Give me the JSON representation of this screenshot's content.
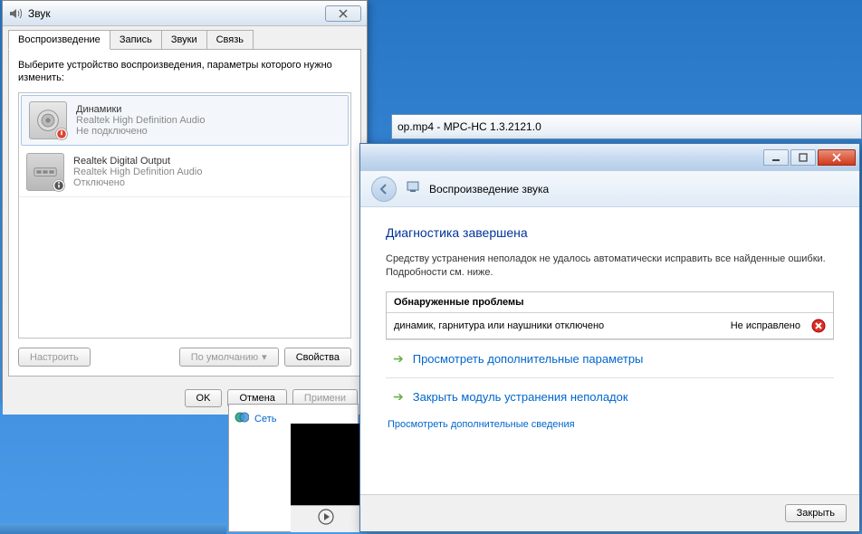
{
  "sound_dialog": {
    "title": "Звук",
    "tabs": [
      "Воспроизведение",
      "Запись",
      "Звуки",
      "Связь"
    ],
    "active_tab": 0,
    "instruction": "Выберите устройство воспроизведения, параметры которого нужно изменить:",
    "devices": [
      {
        "name": "Динамики",
        "desc": "Realtek High Definition Audio",
        "status": "Не подключено",
        "selected": true,
        "icon": "speaker"
      },
      {
        "name": "Realtek Digital Output",
        "desc": "Realtek High Definition Audio",
        "status": "Отключено",
        "selected": false,
        "icon": "digital"
      }
    ],
    "buttons": {
      "configure": "Настроить",
      "default": "По умолчанию",
      "properties": "Свойства",
      "ok": "OK",
      "cancel": "Отмена",
      "apply": "Примени"
    }
  },
  "mpc": {
    "title": "op.mp4 - MPC-HC 1.3.2121.0"
  },
  "troubleshooter": {
    "header_title": "Воспроизведение звука",
    "diag_title": "Диагностика завершена",
    "diag_desc": "Средству устранения неполадок не удалось автоматически исправить все найденные ошибки. Подробности см. ниже.",
    "problems_header": "Обнаруженные проблемы",
    "problem": {
      "text": "динамик, гарнитура или наушники отключено",
      "status": "Не исправлено"
    },
    "actions": {
      "view_params": "Просмотреть дополнительные параметры",
      "close_module": "Закрыть модуль устранения неполадок"
    },
    "info_link": "Просмотреть дополнительные сведения",
    "close_btn": "Закрыть"
  },
  "network": {
    "label": "Сеть"
  }
}
